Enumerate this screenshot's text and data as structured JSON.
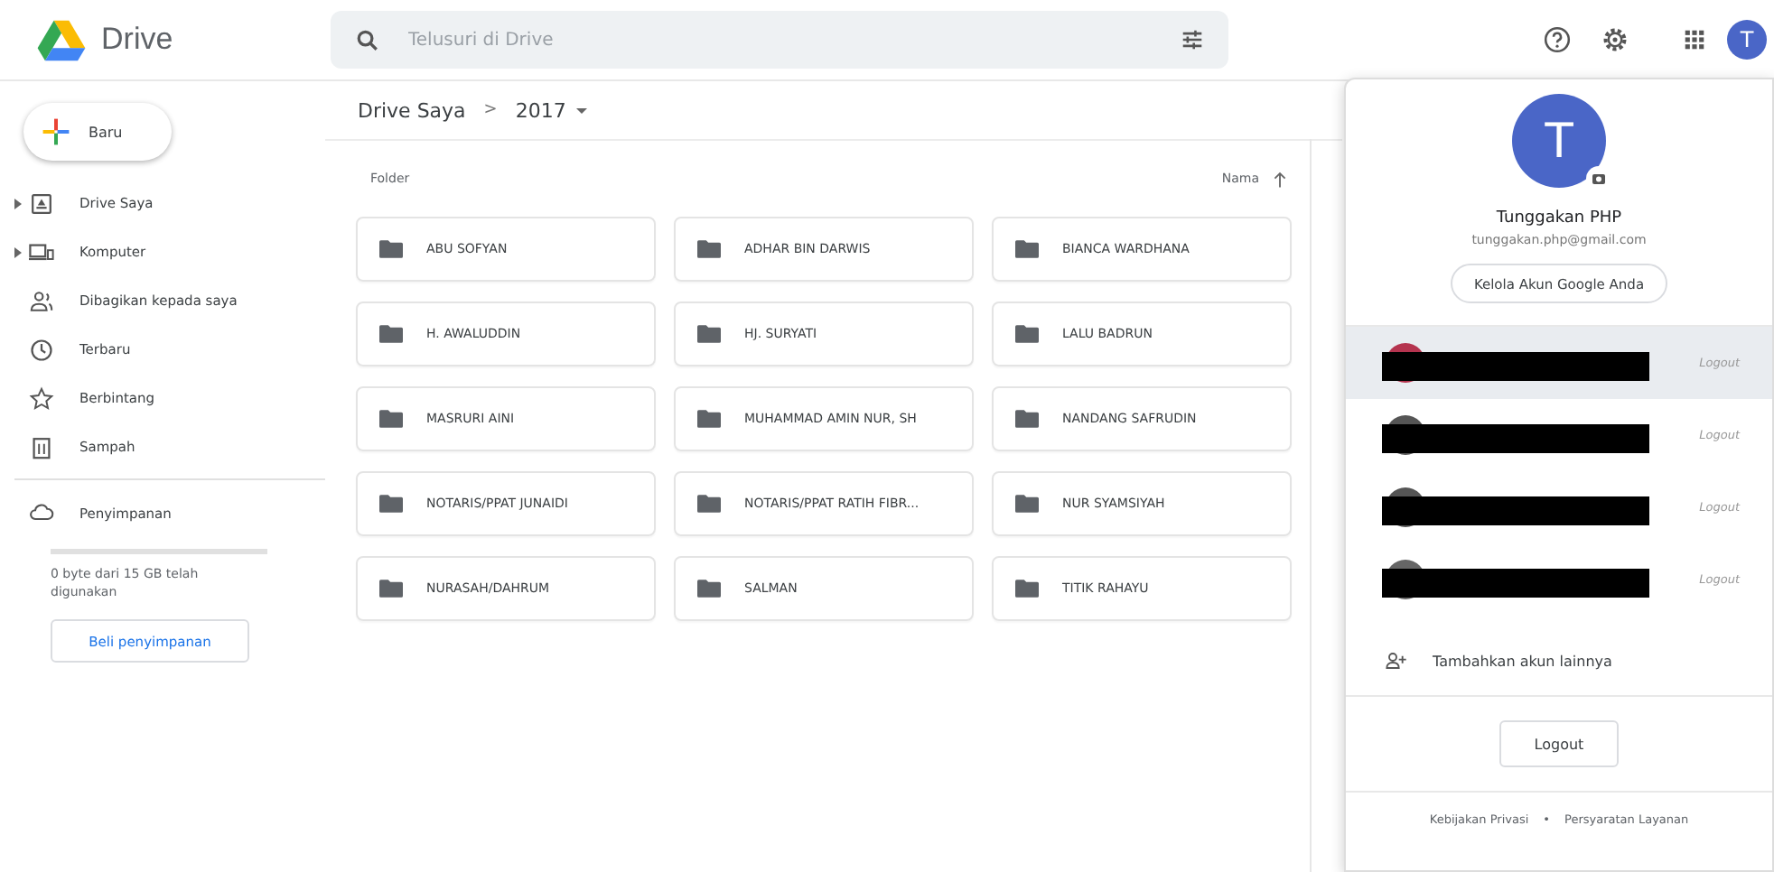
{
  "header": {
    "app_name": "Drive",
    "search": {
      "placeholder": "Telusuri di Drive"
    }
  },
  "sidebar": {
    "new_button": "Baru",
    "items": [
      {
        "label": "Drive Saya",
        "expandable": true
      },
      {
        "label": "Komputer",
        "expandable": true
      },
      {
        "label": "Dibagikan kepada saya",
        "expandable": false
      },
      {
        "label": "Terbaru",
        "expandable": false
      },
      {
        "label": "Berbintang",
        "expandable": false
      },
      {
        "label": "Sampah",
        "expandable": false
      }
    ],
    "storage": {
      "label": "Penyimpanan",
      "level": 0,
      "usage": "0 byte dari 15 GB telah digunakan",
      "buy_button": "Beli penyimpanan"
    }
  },
  "breadcrumb": {
    "parent": "Drive Saya",
    "separator": ">",
    "current": "2017"
  },
  "content": {
    "section_title": "Folder",
    "sort_label": "Nama",
    "folders": [
      "ABU SOFYAN",
      "ADHAR BIN DARWIS",
      "BIANCA WARDHANA",
      "H. AWALUDDIN",
      "HJ. SURYATI",
      "LALU BADRUN",
      "MASRURI AINI",
      "MUHAMMAD AMIN NUR, SH",
      "NANDANG SAFRUDIN",
      "NOTARIS/PPAT JUNAIDI",
      "NOTARIS/PPAT RATIH FIBR...",
      "NUR SYAMSIYAH",
      "NURASAH/DAHRUM",
      "SALMAN",
      "TITIK RAHAYU"
    ]
  },
  "account_panel": {
    "avatar_letter": "T",
    "name": "Tunggakan PHP",
    "email": "tunggakan.php@gmail.com",
    "manage_button": "Kelola Akun Google Anda",
    "accounts": [
      {
        "logout": "Logout",
        "selected": true,
        "color": "#b5344f"
      },
      {
        "logout": "Logout",
        "selected": false,
        "color": "#555555"
      },
      {
        "logout": "Logout",
        "selected": false,
        "color": "#555555"
      },
      {
        "logout": "Logout",
        "selected": false,
        "color": "#666666"
      }
    ],
    "add_account": "Tambahkan akun lainnya",
    "logout_button": "Logout",
    "footer": {
      "privacy": "Kebijakan Privasi",
      "separator": "•",
      "terms": "Persyaratan Layanan"
    }
  },
  "top_avatar_letter": "T"
}
